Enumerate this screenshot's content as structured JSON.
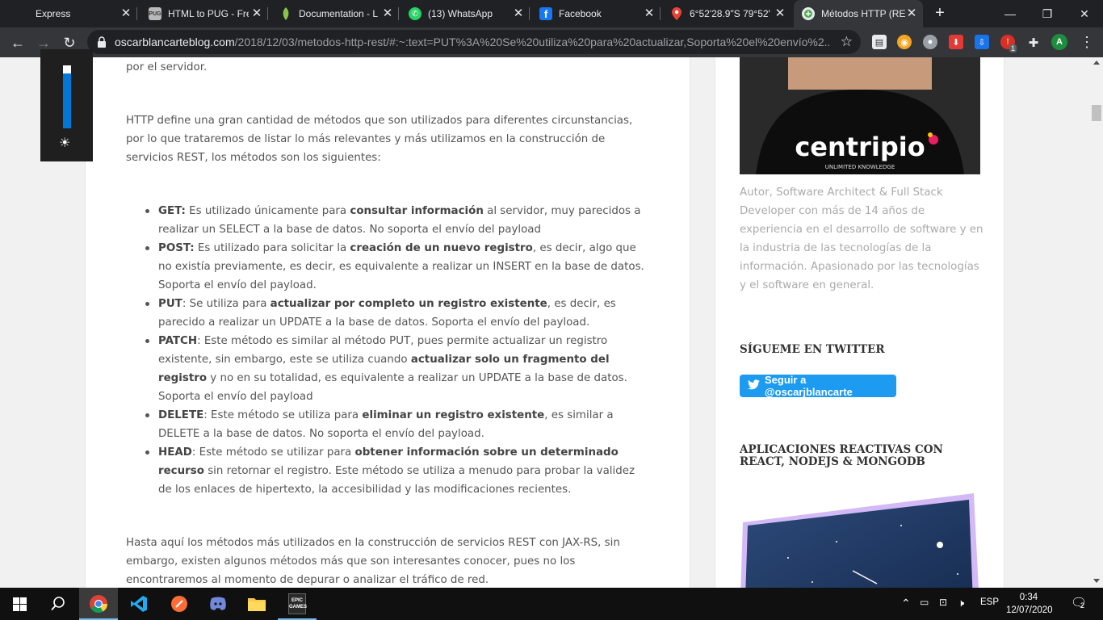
{
  "browser": {
    "tabs": [
      {
        "title": "Express",
        "favicon": "none"
      },
      {
        "title": "HTML to PUG - Fre",
        "favicon": "pug-icon"
      },
      {
        "title": "Documentation - L",
        "favicon": "leaf-icon"
      },
      {
        "title": "(13) WhatsApp",
        "favicon": "whatsapp-icon"
      },
      {
        "title": "Facebook",
        "favicon": "facebook-icon"
      },
      {
        "title": "6°52'28.9\"S 79°52'",
        "favicon": "maps-pin-icon"
      },
      {
        "title": "Métodos HTTP (RE",
        "favicon": "blog-icon",
        "active": true
      }
    ],
    "url_host": "oscarblancarteblog.com",
    "url_path": "/2018/12/03/metodos-http-rest/#:~:text=PUT%3A%20Se%20utiliza%20para%20actualizar,Soporta%20el%20envío%2...",
    "profile_initial": "A",
    "extension_badge": "1"
  },
  "article": {
    "top_fragment": "por el servidor.",
    "intro": "HTTP define una gran cantidad de métodos que son utilizados para diferentes circunstancias, por lo que trataremos de listar lo más relevantes y más utilizamos en la construcción de servicios REST, los métodos son los siguientes:",
    "methods": [
      {
        "name": "GET:",
        "t1": " Es utilizado únicamente para ",
        "strong": "consultar información",
        "t2": " al servidor, muy parecidos a realizar un SELECT a la base de datos. No soporta el envío del payload"
      },
      {
        "name": "POST:",
        "t1": " Es utilizado para solicitar la ",
        "strong": "creación de un nuevo registro",
        "t2": ", es decir, algo que no existía previamente, es decir, es equivalente a realizar un INSERT en la base de datos. Soporta el envío del payload."
      },
      {
        "name": "PUT",
        "t1": ": Se utiliza para ",
        "strong": "actualizar por completo un registro existente",
        "t2": ", es decir, es parecido a realizar un UPDATE a la base de datos. Soporta el envío del payload."
      },
      {
        "name": "PATCH",
        "t1": ": Este método es similar al método PUT, pues permite actualizar un registro existente, sin embargo, este se utiliza cuando ",
        "strong": "actualizar solo un fragmento del registro",
        "t2": " y no en su totalidad, es equivalente a realizar un UPDATE a la base de datos. Soporta el envío del payload"
      },
      {
        "name": "DELETE",
        "t1": ": Este método se utiliza para ",
        "strong": "eliminar un registro existente",
        "t2": ", es similar a DELETE a la base de datos. No soporta el envío del payload."
      },
      {
        "name": "HEAD",
        "t1": ": Este método se utilizar para ",
        "strong": "obtener información sobre un determinado recurso",
        "t2": " sin retornar el registro. Este método se utiliza a menudo para probar la validez de los enlaces de hipertexto, la accesibilidad y las modificaciones recientes."
      }
    ],
    "outro": "Hasta aquí los métodos más utilizados en la construcción de servicios REST con JAX-RS, sin embargo, existen algunos métodos más que son interesantes conocer, pues no los encontraremos al momento de depurar o analizar el tráfico de red."
  },
  "sidebar": {
    "shirt_brand": "centripio",
    "shirt_tagline": "UNLIMITED KNOWLEDGE",
    "bio": "Autor, Software Architect & Full Stack Developer con más de 14 años de experiencia en el desarrollo de software y en la industria de las tecnologías de la información. Apasionado por las tecnologías y el software en general.",
    "twitter_title": "SÍGUEME EN TWITTER",
    "twitter_button": "Seguir a @oscarjblancarte",
    "course_title": "APLICACIONES REACTIVAS CON REACT, NODEJS & MONGODB"
  },
  "taskbar": {
    "lang": "ESP",
    "time": "0:34",
    "date": "12/07/2020",
    "notifications": "2",
    "epic_label": "EPIC\nGAMES"
  },
  "colors": {
    "accent": "#1d9bf0",
    "brightness": "#0078d7"
  }
}
